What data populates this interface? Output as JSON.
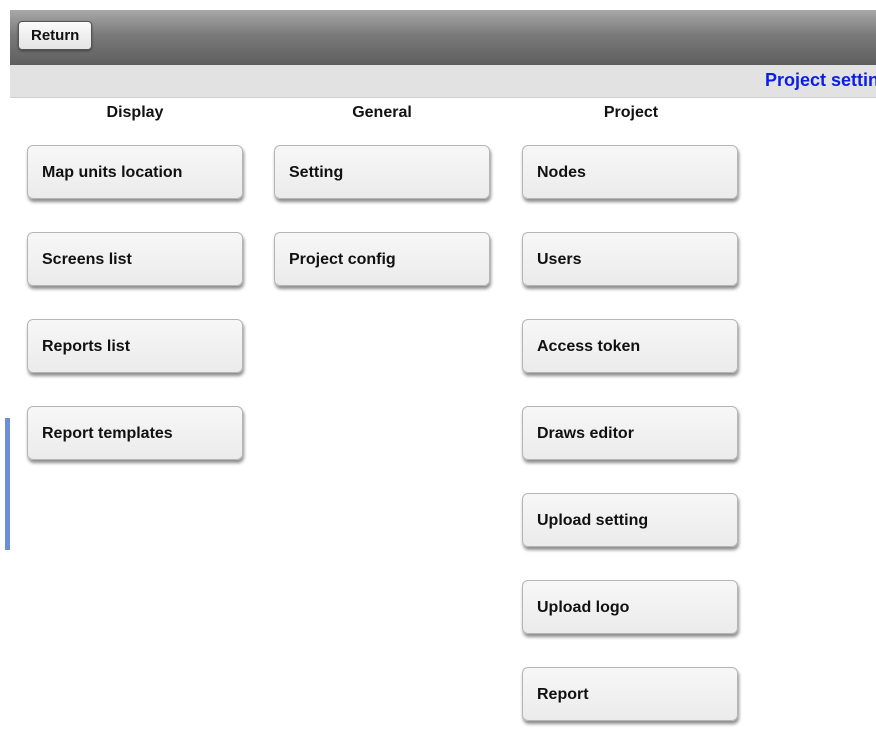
{
  "toolbar": {
    "return_label": "Return"
  },
  "header": {
    "title": "Project setting"
  },
  "columns": {
    "display": {
      "header": "Display",
      "buttons": [
        "Map units location",
        "Screens list",
        "Reports list",
        "Report templates"
      ]
    },
    "general": {
      "header": "General",
      "buttons": [
        "Setting",
        "Project config"
      ]
    },
    "project": {
      "header": "Project",
      "buttons": [
        "Nodes",
        "Users",
        "Access token",
        "Draws editor",
        "Upload setting",
        "Upload logo",
        "Report"
      ]
    }
  },
  "colors": {
    "title": "#0a1ee6",
    "accent_bar": "#6d8fd6"
  }
}
